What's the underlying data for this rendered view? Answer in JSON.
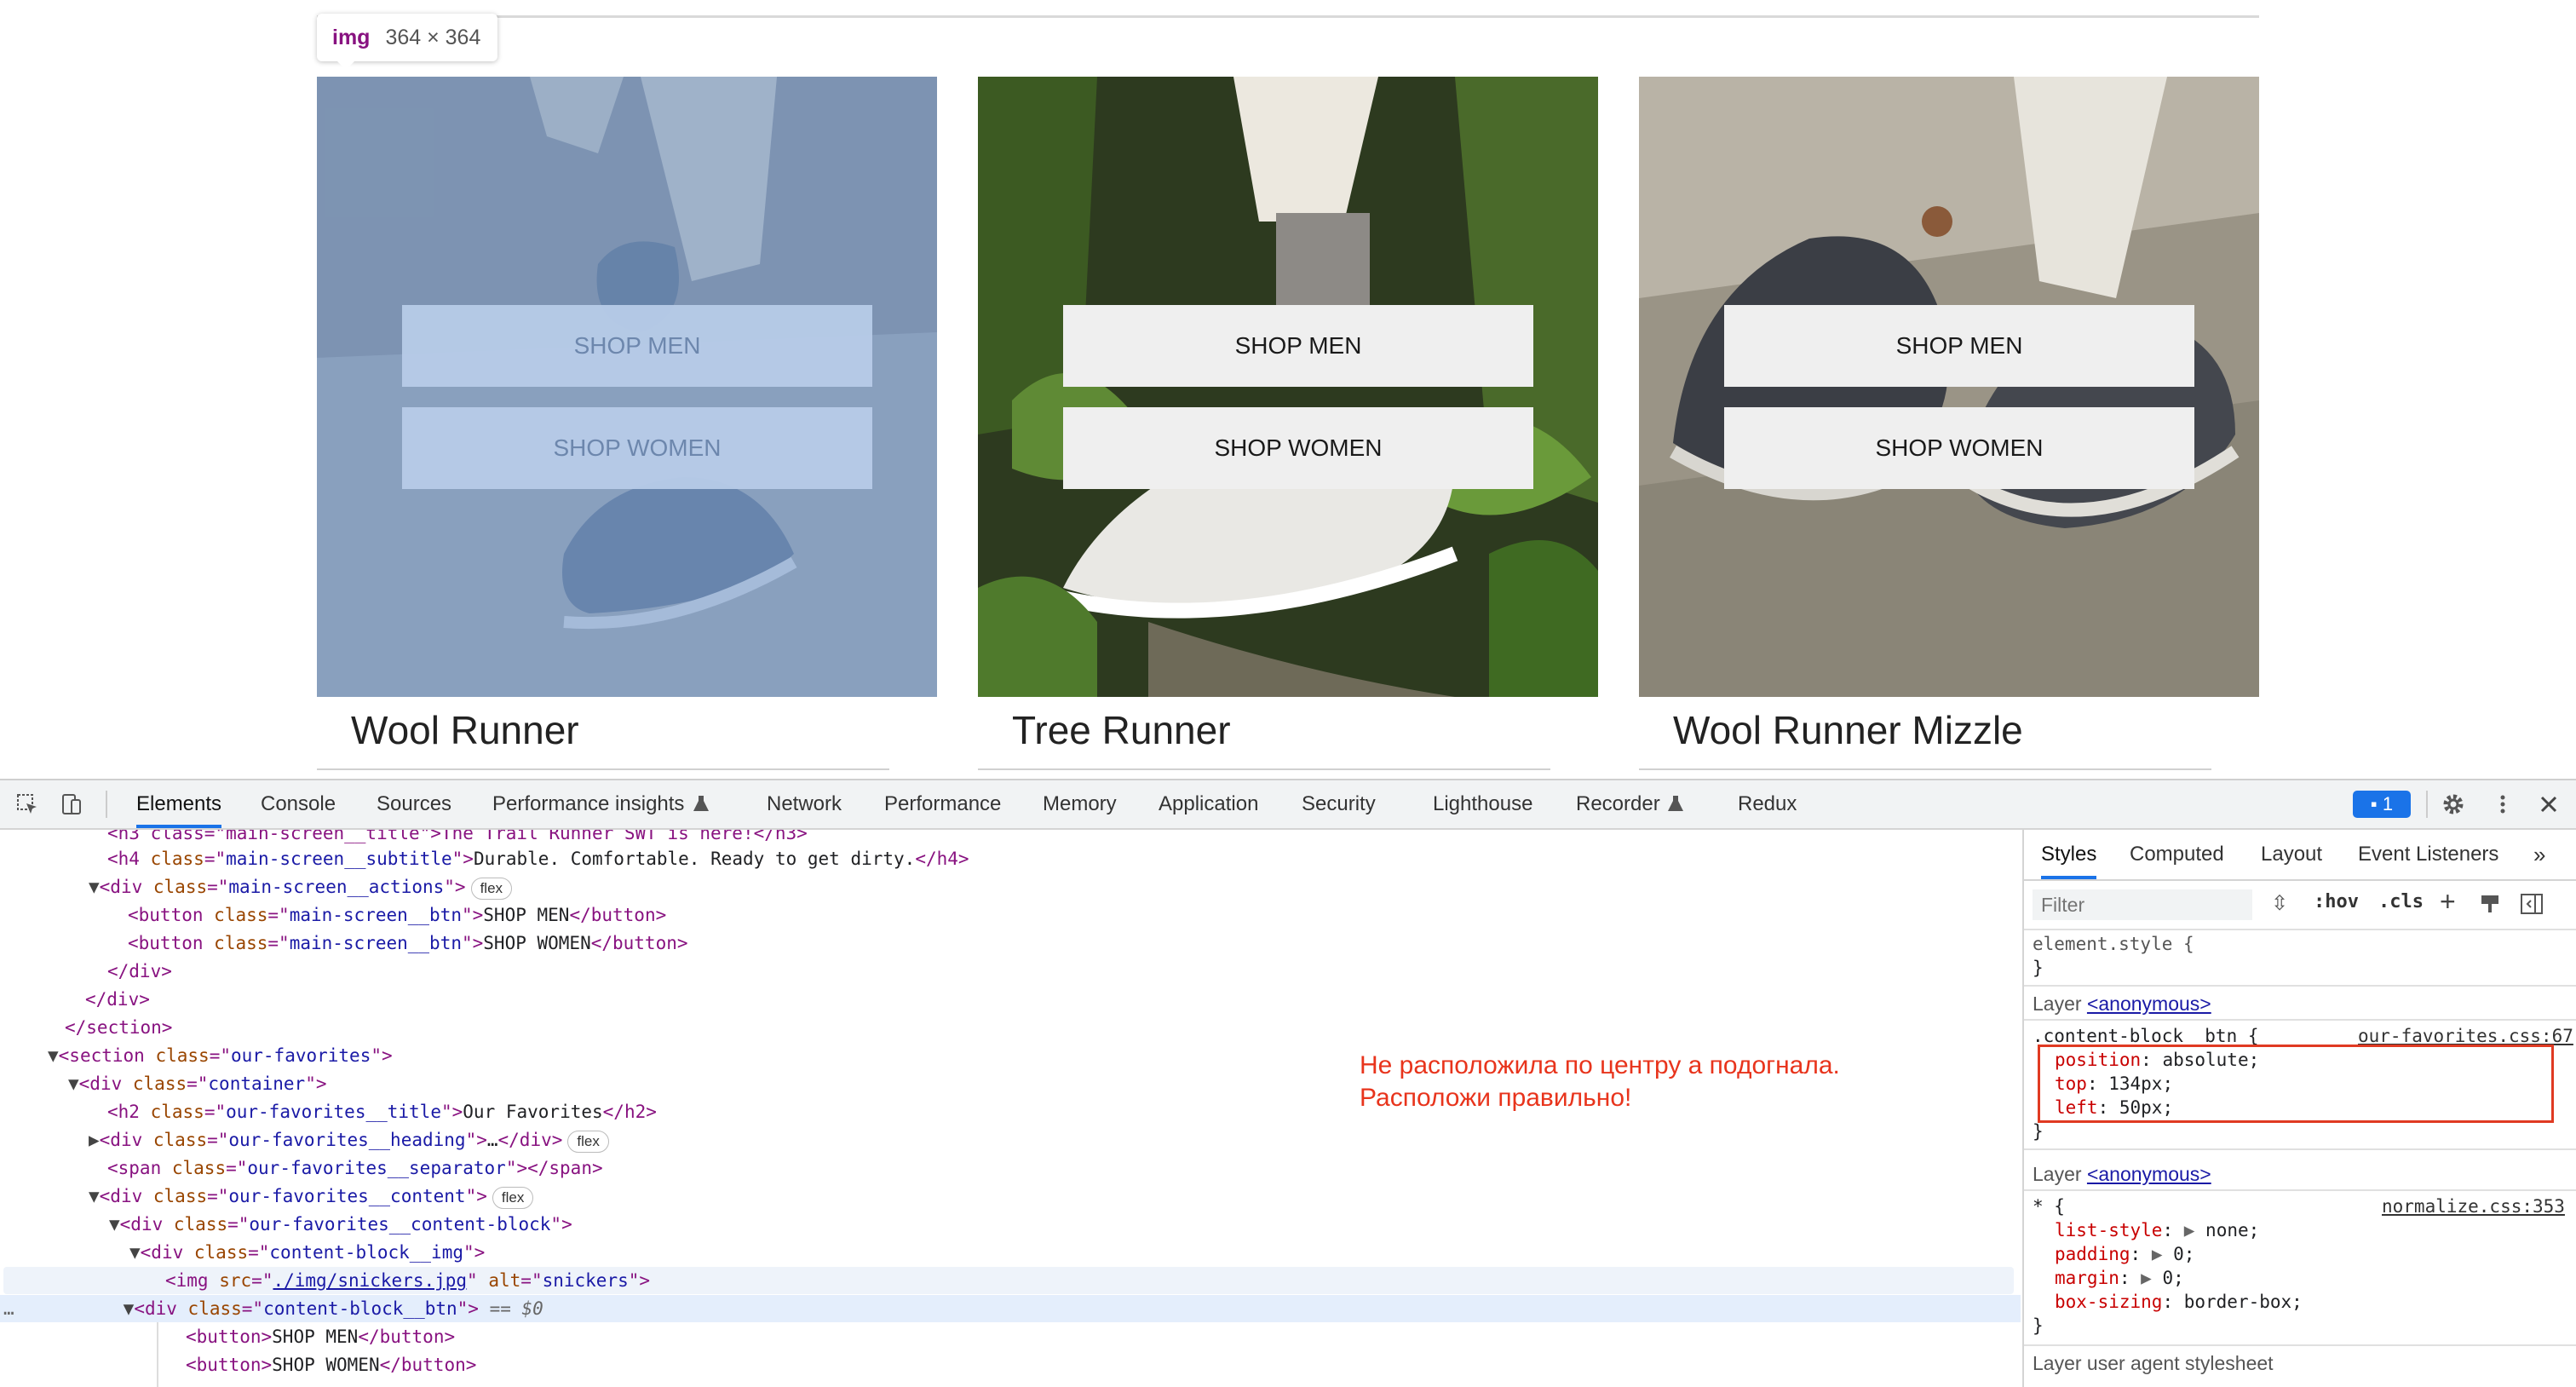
{
  "tooltip": {
    "tag": "img",
    "dims": "364 × 364"
  },
  "cards": [
    {
      "title": "Wool Runner",
      "men": "SHOP MEN",
      "women": "SHOP WOMEN"
    },
    {
      "title": "Tree Runner",
      "men": "SHOP MEN",
      "women": "SHOP WOMEN"
    },
    {
      "title": "Wool Runner Mizzle",
      "men": "SHOP MEN",
      "women": "SHOP WOMEN"
    }
  ],
  "devtools": {
    "tabs": [
      "Elements",
      "Console",
      "Sources",
      "Performance insights",
      "Network",
      "Performance",
      "Memory",
      "Application",
      "Security",
      "Lighthouse",
      "Recorder",
      "Redux"
    ],
    "issues_count": "1",
    "note_line1": "Не расположила по центру а подогнала.",
    "note_line2": "Расположи правильно!",
    "dom": {
      "l0": "<h3 class=\"main-screen__title\">The Trail Runner SWT is here!</h3>",
      "l1_tag": "h4",
      "l1_class": "main-screen__subtitle",
      "l1_text": "Durable. Comfortable. Ready to get dirty.",
      "l2_class": "main-screen__actions",
      "l3_class": "main-screen__btn",
      "l3_text": "SHOP MEN",
      "l4_class": "main-screen__btn",
      "l4_text": "SHOP WOMEN",
      "l7_class": "our-favorites",
      "l8_class": "container",
      "l9_class": "our-favorites__title",
      "l9_text": "Our Favorites",
      "l10_class": "our-favorites__heading",
      "l11_class": "our-favorites__separator",
      "l12_class": "our-favorites__content",
      "l13_class": "our-favorites__content-block",
      "l14_class": "content-block__img",
      "l15_src": "./img/snickers.jpg",
      "l15_alt": "snickers",
      "l16_class": "content-block__btn",
      "l16_eq": "== $0",
      "l17_text": "SHOP MEN",
      "l18_text": "SHOP WOMEN",
      "flex": "flex"
    },
    "styles": {
      "tabs": [
        "Styles",
        "Computed",
        "Layout",
        "Event Listeners"
      ],
      "filter_placeholder": "Filter",
      "hov": ":hov",
      "cls": ".cls",
      "element_style": "element.style {",
      "close": "}",
      "layer_label": "Layer",
      "anonymous": "<anonymous>",
      "rule1_selector": ".content-block__btn {",
      "rule1_source": "our-favorites.css:67",
      "rule1_props": [
        {
          "name": "position",
          "value": "absolute;"
        },
        {
          "name": "top",
          "value": "134px;"
        },
        {
          "name": "left",
          "value": "50px;"
        }
      ],
      "rule2_selector": "* {",
      "rule2_source": "normalize.css:353",
      "rule2_props": [
        {
          "name": "list-style",
          "value": "none;"
        },
        {
          "name": "padding",
          "value": "0;"
        },
        {
          "name": "margin",
          "value": "0;"
        },
        {
          "name": "box-sizing",
          "value": "border-box;"
        }
      ],
      "ua_label": "Layer user agent stylesheet"
    }
  },
  "colors": {
    "accent": "#1a73e8",
    "note": "#e8341c",
    "highlight_overlay": "#6f98cd"
  }
}
